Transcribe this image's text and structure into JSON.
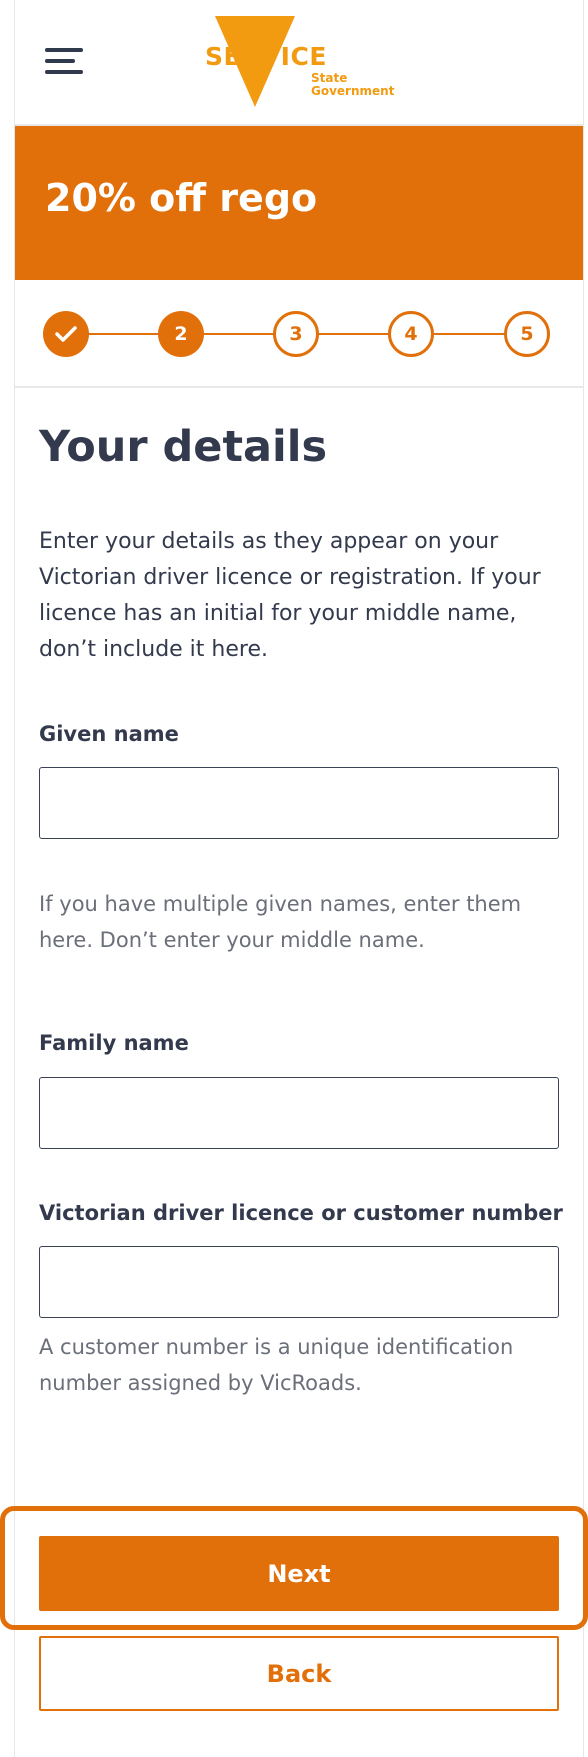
{
  "header": {
    "logo_text": "SERVICE",
    "logo_subtext_line1": "State",
    "logo_subtext_line2": "Government",
    "menu_icon": "hamburger-menu-icon"
  },
  "banner": {
    "title": "20% off rego"
  },
  "stepper": {
    "steps": [
      {
        "label": "✓",
        "state": "done"
      },
      {
        "label": "2",
        "state": "current"
      },
      {
        "label": "3",
        "state": "future"
      },
      {
        "label": "4",
        "state": "future"
      },
      {
        "label": "5",
        "state": "future"
      }
    ]
  },
  "form": {
    "title": "Your details",
    "intro": "Enter your details as they appear on your Victorian driver licence or registration. If your licence has an initial for your middle name, don’t include it here.",
    "given_name": {
      "label": "Given name",
      "value": "",
      "hint": "If you have multiple given names, enter them here. Don’t enter your middle name."
    },
    "family_name": {
      "label": "Family name",
      "value": ""
    },
    "licence": {
      "label": "Victorian driver licence or customer number",
      "value": "",
      "hint": "A customer number is a unique identification number assigned by VicRoads."
    }
  },
  "actions": {
    "next_label": "Next",
    "back_label": "Back"
  },
  "colors": {
    "accent": "#e1700b",
    "logo": "#f29b11",
    "text": "#333a4d",
    "hint": "#6b6f7a"
  }
}
